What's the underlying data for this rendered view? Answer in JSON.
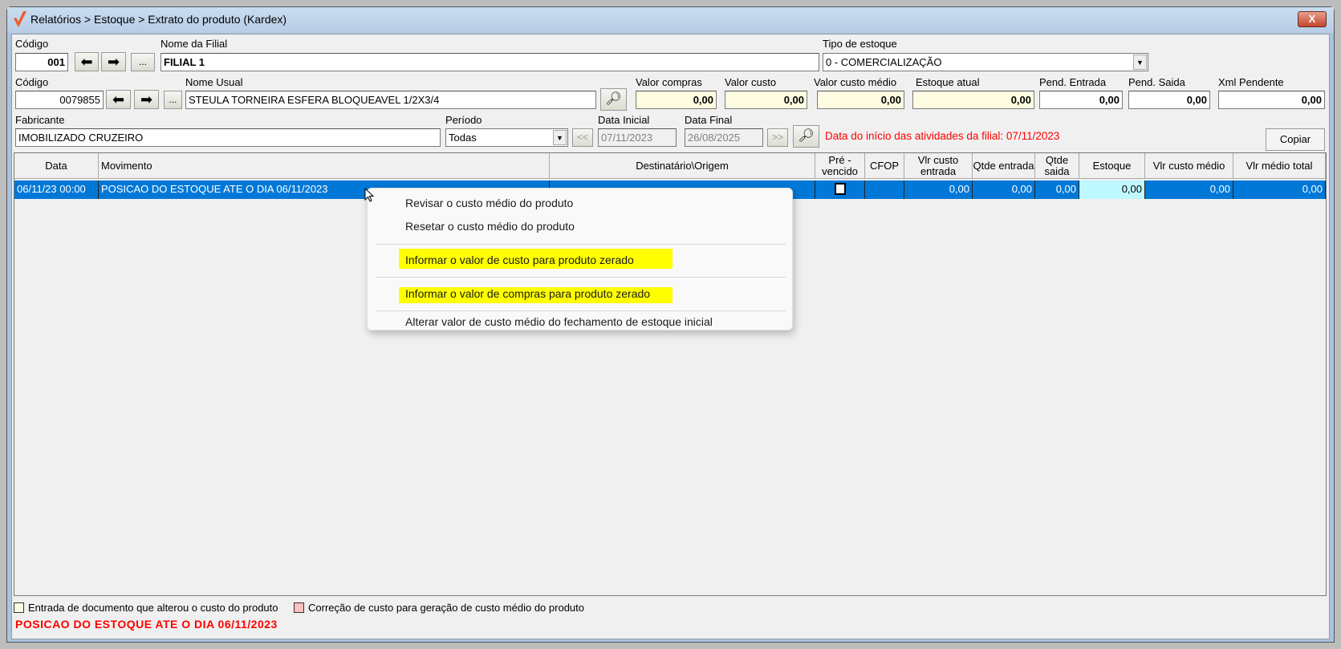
{
  "window": {
    "title": "Relatórios > Estoque > Extrato do produto (Kardex)",
    "close_label": "X"
  },
  "filial": {
    "codigo_label": "Código",
    "codigo": "001",
    "nome_label": "Nome da Filial",
    "nome": "FILIAL 1",
    "tipo_label": "Tipo de estoque",
    "tipo": "0 - COMERCIALIZAÇÃO",
    "more_label": "..."
  },
  "produto": {
    "codigo_label": "Código",
    "codigo": "0079855",
    "nome_label": "Nome Usual",
    "nome": "STEULA TORNEIRA ESFERA BLOQUEAVEL 1/2X3/4",
    "more_label": "..."
  },
  "valores": [
    {
      "label": "Valor compras",
      "value": "0,00"
    },
    {
      "label": "Valor custo",
      "value": "0,00"
    },
    {
      "label": "Valor custo médio",
      "value": "0,00"
    },
    {
      "label": "Estoque atual",
      "value": "0,00"
    },
    {
      "label": "Pend. Entrada",
      "value": "0,00"
    },
    {
      "label": "Pend. Saida",
      "value": "0,00"
    },
    {
      "label": "Xml Pendente",
      "value": "0,00"
    }
  ],
  "fabricante": {
    "label": "Fabricante",
    "value": "IMOBILIZADO CRUZEIRO"
  },
  "periodo": {
    "label": "Período",
    "value": "Todas",
    "prev_label": "<<",
    "next_label": ">>",
    "data_inicial_label": "Data Inicial",
    "data_inicial": "07/11/2023",
    "data_final_label": "Data Final",
    "data_final": "26/08/2025"
  },
  "info_text": "Data do início das atividades da filial: 07/11/2023",
  "copiar_label": "Copiar",
  "grid": {
    "columns": [
      "Data",
      "Movimento",
      "Destinatário\\Origem",
      "Pré - vencido",
      "CFOP",
      "Vlr custo entrada",
      "Qtde entrada",
      "Qtde saida",
      "Estoque",
      "Vlr custo médio",
      "Vlr médio total"
    ],
    "rows": [
      {
        "data": "06/11/23 00:00",
        "movimento": "POSICAO DO ESTOQUE ATE O DIA 06/11/2023",
        "destino": "",
        "cfop": "",
        "vlr_custo_entrada": "0,00",
        "qtde_entrada": "0,00",
        "qtde_saida": "0,00",
        "estoque": "0,00",
        "vlr_custo_medio": "0,00",
        "vlr_medio_total": "0,00"
      }
    ]
  },
  "context_menu": [
    "Revisar o custo médio do produto",
    "Resetar o custo médio do produto",
    "Informar o valor de custo para produto zerado",
    "Informar o valor de compras para produto zerado",
    "Alterar valor de custo médio do fechamento de estoque inicial"
  ],
  "legend": [
    {
      "label": "Entrada de documento que alterou o custo do produto",
      "color": "#fffde1"
    },
    {
      "label": "Correção de custo para geração de custo médio do produto",
      "color": "#ffc0c0"
    }
  ],
  "status_text": "POSICAO DO ESTOQUE ATE O DIA 06/11/2023"
}
